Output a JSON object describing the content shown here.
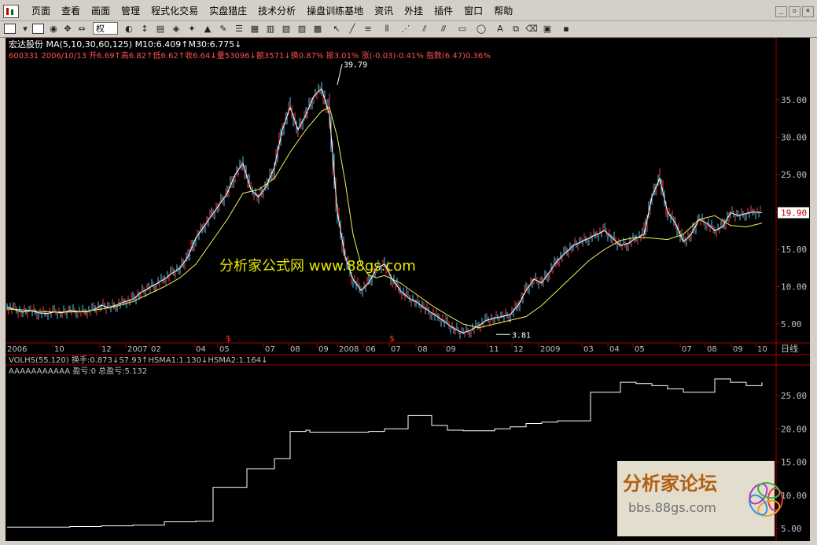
{
  "menu": [
    "页面",
    "查看",
    "画面",
    "管理",
    "程式化交易",
    "实盘猎庄",
    "技术分析",
    "操盘训练基地",
    "资讯",
    "外挂",
    "插件",
    "窗口",
    "帮助"
  ],
  "toolbar": {
    "right_label": "权"
  },
  "stock": {
    "line1": "宏达股份  MA(5,10,30,60,125)  M10:6.409↑M30:6.775↓",
    "line2": "600331  2006/10/13  开6.69↑高6.82↑低6.62↑收6.64↓量53096↓额3571↓换0.87%  振3.01%  涨(-0.03)-0.41%  指数(6.47)0.36%"
  },
  "watermark": "分析家公式网  www.88gs.com",
  "logo": {
    "title": "分析家论坛",
    "url": "bbs.88gs.com"
  },
  "panels": {
    "vol_label": "VOLHS(55,120)  换手:0.873↓S7.93↑HSMA1:1.130↓HSMA2:1.164↓",
    "ind_label": "AAAAAAAAAAA  盈亏:0  总盈亏:5.132",
    "period": "日线",
    "current_price": "19.90",
    "high_label": "39.79",
    "low_label": "3.81"
  },
  "chart_data": {
    "type": "line",
    "title": "宏达股份 600331",
    "main_yticks": [
      "35.00",
      "30.00",
      "25.00",
      "20.00",
      "15.00",
      "10.00",
      "5.00"
    ],
    "lower_yticks": [
      "25.00",
      "20.00",
      "15.00",
      "10.00",
      "5.00"
    ],
    "x_ticks": [
      "2006",
      "10",
      "12",
      "2007",
      "02",
      "04",
      "05",
      "07",
      "08",
      "09",
      "2008",
      "06",
      "07",
      "08",
      "09",
      "11",
      "12",
      "2009",
      "03",
      "04",
      "05",
      "07",
      "08",
      "09",
      "10"
    ],
    "price_series": {
      "name": "close",
      "x": [
        0,
        10,
        20,
        30,
        40,
        50,
        60,
        70,
        80,
        90,
        100,
        110,
        120,
        130,
        140,
        150,
        160,
        170,
        180,
        190,
        200,
        210,
        220,
        230,
        240,
        250,
        260,
        270,
        280,
        290,
        300,
        310,
        320,
        330,
        340,
        350,
        360,
        370,
        380,
        390,
        400,
        410,
        420,
        430,
        440,
        450,
        460,
        470,
        480,
        490,
        500,
        510,
        520,
        530,
        540,
        550,
        560,
        570,
        580,
        590,
        600,
        610,
        620,
        630,
        640,
        650,
        660,
        670,
        680,
        690,
        700,
        710,
        720,
        730,
        740,
        750,
        760,
        770,
        780,
        790,
        800,
        810,
        820,
        830,
        840,
        850,
        860,
        870,
        880,
        890,
        900,
        910,
        920,
        930,
        940,
        950,
        960
      ],
      "y": [
        7.3,
        6.9,
        6.6,
        6.8,
        6.5,
        6.4,
        6.6,
        6.5,
        6.8,
        6.7,
        6.6,
        6.9,
        7.5,
        7.2,
        7.6,
        8.0,
        8.3,
        9.2,
        9.8,
        10.4,
        11.0,
        11.8,
        12.5,
        14.0,
        16.5,
        18.0,
        19.5,
        21.0,
        22.5,
        25.0,
        26.5,
        23.0,
        22.0,
        23.5,
        26.0,
        31.0,
        34.0,
        31.0,
        33.0,
        35.5,
        36.5,
        33.0,
        20.0,
        14.0,
        11.0,
        9.5,
        10.5,
        12.5,
        13.0,
        11.0,
        9.5,
        8.5,
        8.0,
        7.2,
        6.5,
        5.8,
        5.0,
        4.3,
        3.81,
        4.2,
        4.8,
        5.5,
        5.8,
        6.0,
        6.3,
        7.5,
        9.5,
        11.0,
        10.5,
        12.0,
        13.5,
        14.5,
        15.5,
        16.0,
        16.5,
        17.0,
        17.5,
        16.5,
        15.5,
        15.8,
        16.5,
        17.0,
        22.0,
        24.5,
        20.0,
        18.5,
        16.0,
        17.0,
        19.0,
        18.5,
        17.5,
        18.0,
        19.9,
        19.5,
        19.8,
        20.0,
        19.9
      ]
    },
    "ma_series": {
      "name": "MA",
      "x": [
        0,
        20,
        40,
        60,
        80,
        100,
        120,
        140,
        160,
        180,
        200,
        220,
        240,
        260,
        280,
        300,
        320,
        340,
        360,
        380,
        400,
        410,
        420,
        430,
        440,
        450,
        460,
        470,
        480,
        500,
        520,
        540,
        560,
        580,
        600,
        620,
        640,
        660,
        680,
        700,
        720,
        740,
        760,
        780,
        800,
        820,
        840,
        860,
        880,
        900,
        920,
        940,
        960
      ],
      "y": [
        7.0,
        6.9,
        6.7,
        6.6,
        6.6,
        6.7,
        7.0,
        7.4,
        8.0,
        9.0,
        10.0,
        11.2,
        13.0,
        16.0,
        19.0,
        22.5,
        23.0,
        24.5,
        28.0,
        31.0,
        33.5,
        34.0,
        30.0,
        24.0,
        17.0,
        13.0,
        11.5,
        11.2,
        11.5,
        10.5,
        9.0,
        7.5,
        6.2,
        5.0,
        4.5,
        5.0,
        5.5,
        6.0,
        7.5,
        9.5,
        11.5,
        13.5,
        15.0,
        16.2,
        16.6,
        16.5,
        16.3,
        17.0,
        19.0,
        19.5,
        18.2,
        18.0,
        18.5
      ]
    },
    "pnl_series": {
      "name": "总盈亏",
      "x": [
        0,
        40,
        80,
        120,
        160,
        180,
        200,
        220,
        240,
        260,
        262,
        280,
        300,
        305,
        320,
        340,
        345,
        360,
        380,
        385,
        400,
        420,
        440,
        460,
        480,
        500,
        510,
        520,
        540,
        560,
        580,
        600,
        620,
        640,
        660,
        680,
        700,
        720,
        740,
        742,
        760,
        780,
        790,
        800,
        820,
        840,
        860,
        880,
        900,
        920,
        940,
        960
      ],
      "y": [
        5.2,
        5.2,
        5.3,
        5.4,
        5.5,
        5.5,
        6.0,
        6.0,
        6.1,
        6.1,
        11.2,
        11.2,
        11.2,
        14.0,
        14.0,
        15.5,
        15.5,
        19.6,
        19.8,
        19.5,
        19.5,
        19.5,
        19.5,
        19.6,
        20.0,
        20.0,
        22.0,
        22.0,
        20.5,
        19.8,
        19.7,
        19.7,
        20.0,
        20.3,
        20.8,
        21.0,
        21.2,
        21.2,
        21.2,
        25.5,
        25.5,
        27.0,
        27.0,
        26.8,
        26.5,
        26.0,
        25.5,
        25.5,
        27.5,
        27.0,
        26.5,
        27.0
      ]
    }
  }
}
